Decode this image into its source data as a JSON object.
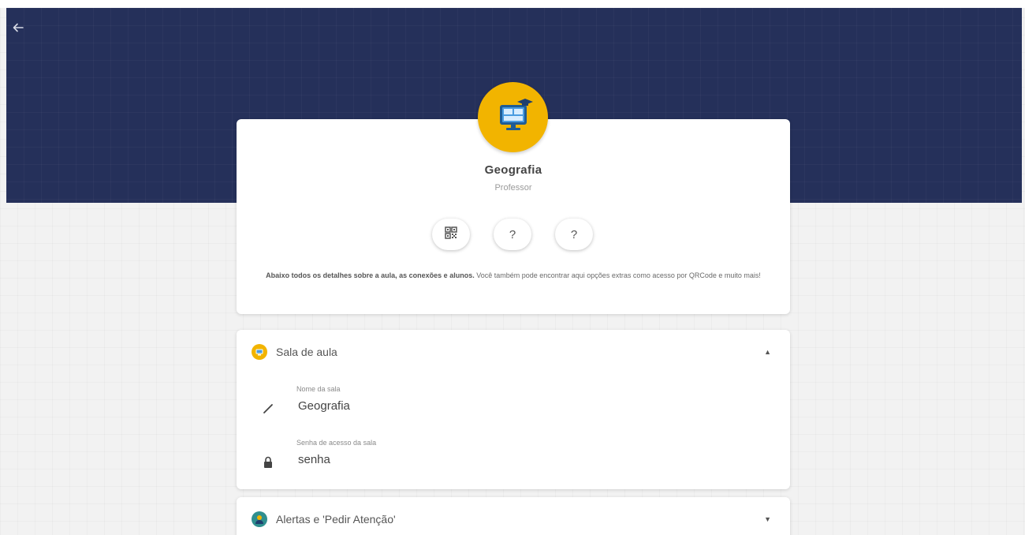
{
  "header": {
    "back_icon": "arrow-left-icon"
  },
  "class_card": {
    "avatar_icon": "classroom-monitor-icon",
    "title": "Geografia",
    "role": "Professor",
    "actions": [
      {
        "icon": "qrcode-icon",
        "label": ""
      },
      {
        "icon": "help-icon",
        "label": "?"
      },
      {
        "icon": "help-icon",
        "label": "?"
      }
    ],
    "description_bold": "Abaixo todos os detalhes sobre a aula, as conexões e alunos.",
    "description_rest": " Você também pode encontrar aqui opções extras como acesso por QRCode e muito mais!"
  },
  "sala_section": {
    "title": "Sala de aula",
    "icon": "classroom-icon",
    "expanded": true,
    "fields": [
      {
        "label": "Nome da sala",
        "value": "Geografia",
        "icon": "pencil-icon"
      },
      {
        "label": "Senha de acesso da sala",
        "value": "senha",
        "icon": "lock-icon"
      }
    ]
  },
  "alertas_section": {
    "title": "Alertas e 'Pedir Atenção'",
    "icon": "alert-user-icon",
    "expanded": false
  },
  "colors": {
    "header_bg": "#25305a",
    "accent": "#f2b400",
    "page_bg": "#f2f2f2"
  }
}
